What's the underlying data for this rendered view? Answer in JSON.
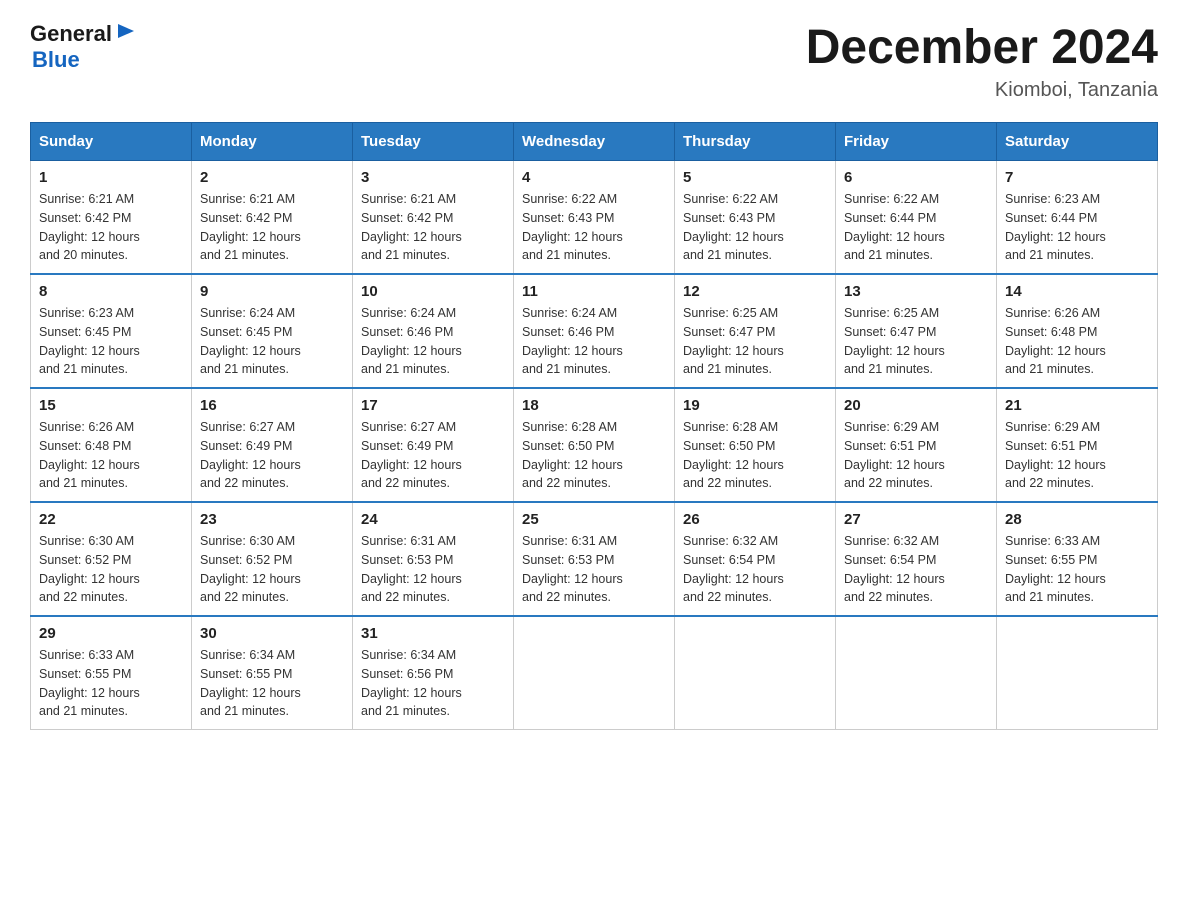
{
  "logo": {
    "general": "General",
    "arrow": "▶",
    "blue": "Blue"
  },
  "title": "December 2024",
  "location": "Kiomboi, Tanzania",
  "days_of_week": [
    "Sunday",
    "Monday",
    "Tuesday",
    "Wednesday",
    "Thursday",
    "Friday",
    "Saturday"
  ],
  "weeks": [
    [
      {
        "day": "1",
        "sunrise": "6:21 AM",
        "sunset": "6:42 PM",
        "daylight": "12 hours and 20 minutes."
      },
      {
        "day": "2",
        "sunrise": "6:21 AM",
        "sunset": "6:42 PM",
        "daylight": "12 hours and 21 minutes."
      },
      {
        "day": "3",
        "sunrise": "6:21 AM",
        "sunset": "6:42 PM",
        "daylight": "12 hours and 21 minutes."
      },
      {
        "day": "4",
        "sunrise": "6:22 AM",
        "sunset": "6:43 PM",
        "daylight": "12 hours and 21 minutes."
      },
      {
        "day": "5",
        "sunrise": "6:22 AM",
        "sunset": "6:43 PM",
        "daylight": "12 hours and 21 minutes."
      },
      {
        "day": "6",
        "sunrise": "6:22 AM",
        "sunset": "6:44 PM",
        "daylight": "12 hours and 21 minutes."
      },
      {
        "day": "7",
        "sunrise": "6:23 AM",
        "sunset": "6:44 PM",
        "daylight": "12 hours and 21 minutes."
      }
    ],
    [
      {
        "day": "8",
        "sunrise": "6:23 AM",
        "sunset": "6:45 PM",
        "daylight": "12 hours and 21 minutes."
      },
      {
        "day": "9",
        "sunrise": "6:24 AM",
        "sunset": "6:45 PM",
        "daylight": "12 hours and 21 minutes."
      },
      {
        "day": "10",
        "sunrise": "6:24 AM",
        "sunset": "6:46 PM",
        "daylight": "12 hours and 21 minutes."
      },
      {
        "day": "11",
        "sunrise": "6:24 AM",
        "sunset": "6:46 PM",
        "daylight": "12 hours and 21 minutes."
      },
      {
        "day": "12",
        "sunrise": "6:25 AM",
        "sunset": "6:47 PM",
        "daylight": "12 hours and 21 minutes."
      },
      {
        "day": "13",
        "sunrise": "6:25 AM",
        "sunset": "6:47 PM",
        "daylight": "12 hours and 21 minutes."
      },
      {
        "day": "14",
        "sunrise": "6:26 AM",
        "sunset": "6:48 PM",
        "daylight": "12 hours and 21 minutes."
      }
    ],
    [
      {
        "day": "15",
        "sunrise": "6:26 AM",
        "sunset": "6:48 PM",
        "daylight": "12 hours and 21 minutes."
      },
      {
        "day": "16",
        "sunrise": "6:27 AM",
        "sunset": "6:49 PM",
        "daylight": "12 hours and 22 minutes."
      },
      {
        "day": "17",
        "sunrise": "6:27 AM",
        "sunset": "6:49 PM",
        "daylight": "12 hours and 22 minutes."
      },
      {
        "day": "18",
        "sunrise": "6:28 AM",
        "sunset": "6:50 PM",
        "daylight": "12 hours and 22 minutes."
      },
      {
        "day": "19",
        "sunrise": "6:28 AM",
        "sunset": "6:50 PM",
        "daylight": "12 hours and 22 minutes."
      },
      {
        "day": "20",
        "sunrise": "6:29 AM",
        "sunset": "6:51 PM",
        "daylight": "12 hours and 22 minutes."
      },
      {
        "day": "21",
        "sunrise": "6:29 AM",
        "sunset": "6:51 PM",
        "daylight": "12 hours and 22 minutes."
      }
    ],
    [
      {
        "day": "22",
        "sunrise": "6:30 AM",
        "sunset": "6:52 PM",
        "daylight": "12 hours and 22 minutes."
      },
      {
        "day": "23",
        "sunrise": "6:30 AM",
        "sunset": "6:52 PM",
        "daylight": "12 hours and 22 minutes."
      },
      {
        "day": "24",
        "sunrise": "6:31 AM",
        "sunset": "6:53 PM",
        "daylight": "12 hours and 22 minutes."
      },
      {
        "day": "25",
        "sunrise": "6:31 AM",
        "sunset": "6:53 PM",
        "daylight": "12 hours and 22 minutes."
      },
      {
        "day": "26",
        "sunrise": "6:32 AM",
        "sunset": "6:54 PM",
        "daylight": "12 hours and 22 minutes."
      },
      {
        "day": "27",
        "sunrise": "6:32 AM",
        "sunset": "6:54 PM",
        "daylight": "12 hours and 22 minutes."
      },
      {
        "day": "28",
        "sunrise": "6:33 AM",
        "sunset": "6:55 PM",
        "daylight": "12 hours and 21 minutes."
      }
    ],
    [
      {
        "day": "29",
        "sunrise": "6:33 AM",
        "sunset": "6:55 PM",
        "daylight": "12 hours and 21 minutes."
      },
      {
        "day": "30",
        "sunrise": "6:34 AM",
        "sunset": "6:55 PM",
        "daylight": "12 hours and 21 minutes."
      },
      {
        "day": "31",
        "sunrise": "6:34 AM",
        "sunset": "6:56 PM",
        "daylight": "12 hours and 21 minutes."
      },
      null,
      null,
      null,
      null
    ]
  ],
  "labels": {
    "sunrise": "Sunrise:",
    "sunset": "Sunset:",
    "daylight": "Daylight:"
  }
}
